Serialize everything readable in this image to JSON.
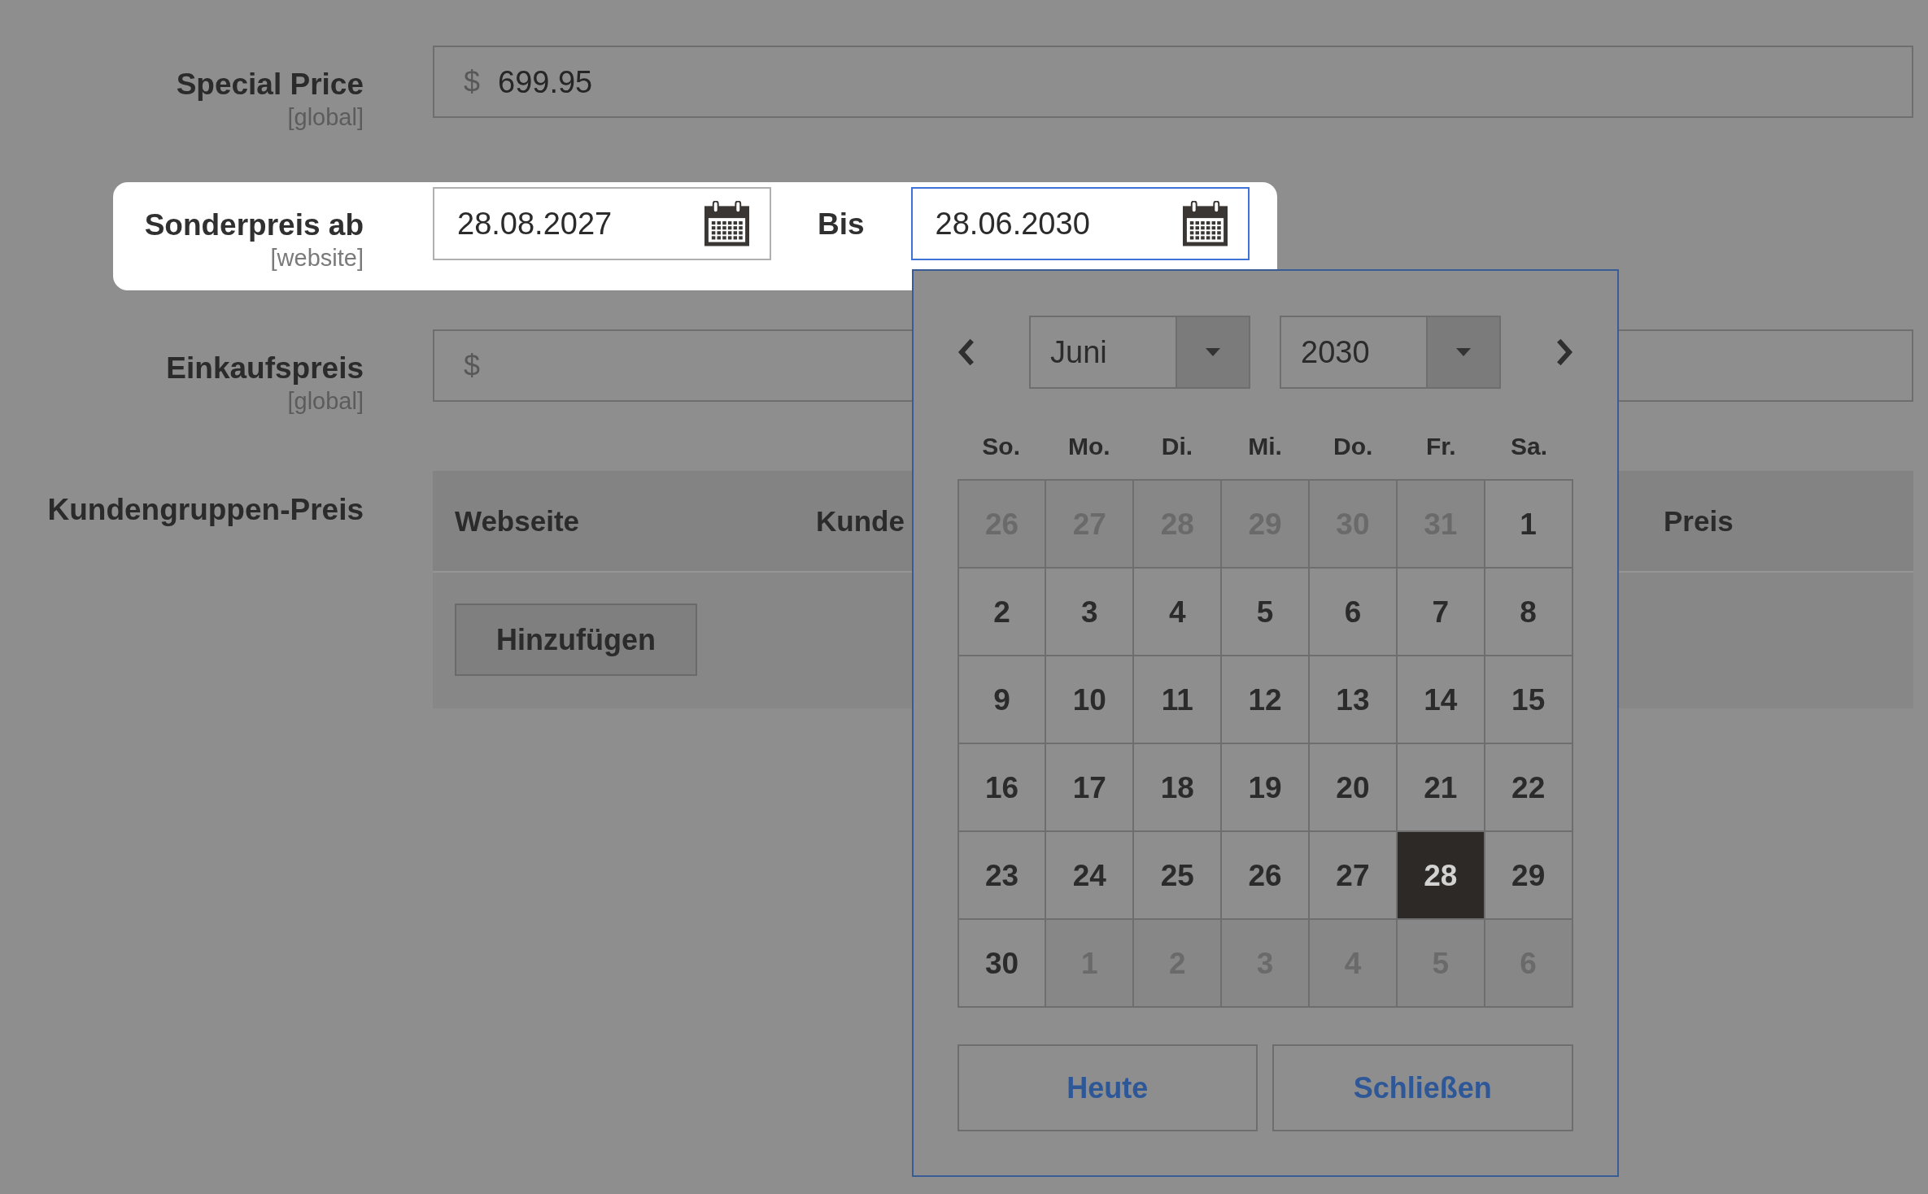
{
  "fields": [
    {
      "kind": "price",
      "label": "Special Price",
      "scope": "[global]",
      "currency": "$",
      "value": "699.95"
    },
    {
      "kind": "date_range",
      "label": "Sonderpreis ab",
      "scope": "[website]",
      "highlighted": true,
      "from": {
        "value": "28.08.2027",
        "focused": false
      },
      "separator": "Bis",
      "to": {
        "value": "28.06.2030",
        "focused": true
      }
    },
    {
      "kind": "price",
      "label": "Einkaufspreis",
      "scope": "[global]",
      "currency": "$"
    },
    {
      "kind": "table",
      "label": "Kundengruppen-Preis",
      "columns": [
        "Webseite",
        "Kunde",
        "Preis"
      ],
      "add_button": "Hinzufügen"
    }
  ],
  "calendar": {
    "month": "Juni",
    "year": "2030",
    "weekdays": [
      "So.",
      "Mo.",
      "Di.",
      "Mi.",
      "Do.",
      "Fr.",
      "Sa."
    ],
    "weeks": [
      [
        {
          "day": "26",
          "outside": true,
          "selected": false
        },
        {
          "day": "27",
          "outside": true,
          "selected": false
        },
        {
          "day": "28",
          "outside": true,
          "selected": false
        },
        {
          "day": "29",
          "outside": true,
          "selected": false
        },
        {
          "day": "30",
          "outside": true,
          "selected": false
        },
        {
          "day": "31",
          "outside": true,
          "selected": false
        },
        {
          "day": "1",
          "outside": false,
          "selected": false
        }
      ],
      [
        {
          "day": "2",
          "outside": false,
          "selected": false
        },
        {
          "day": "3",
          "outside": false,
          "selected": false
        },
        {
          "day": "4",
          "outside": false,
          "selected": false
        },
        {
          "day": "5",
          "outside": false,
          "selected": false
        },
        {
          "day": "6",
          "outside": false,
          "selected": false
        },
        {
          "day": "7",
          "outside": false,
          "selected": false
        },
        {
          "day": "8",
          "outside": false,
          "selected": false
        }
      ],
      [
        {
          "day": "9",
          "outside": false,
          "selected": false
        },
        {
          "day": "10",
          "outside": false,
          "selected": false
        },
        {
          "day": "11",
          "outside": false,
          "selected": false
        },
        {
          "day": "12",
          "outside": false,
          "selected": false
        },
        {
          "day": "13",
          "outside": false,
          "selected": false
        },
        {
          "day": "14",
          "outside": false,
          "selected": false
        },
        {
          "day": "15",
          "outside": false,
          "selected": false
        }
      ],
      [
        {
          "day": "16",
          "outside": false,
          "selected": false
        },
        {
          "day": "17",
          "outside": false,
          "selected": false
        },
        {
          "day": "18",
          "outside": false,
          "selected": false
        },
        {
          "day": "19",
          "outside": false,
          "selected": false
        },
        {
          "day": "20",
          "outside": false,
          "selected": false
        },
        {
          "day": "21",
          "outside": false,
          "selected": false
        },
        {
          "day": "22",
          "outside": false,
          "selected": false
        }
      ],
      [
        {
          "day": "23",
          "outside": false,
          "selected": false
        },
        {
          "day": "24",
          "outside": false,
          "selected": false
        },
        {
          "day": "25",
          "outside": false,
          "selected": false
        },
        {
          "day": "26",
          "outside": false,
          "selected": false
        },
        {
          "day": "27",
          "outside": false,
          "selected": false
        },
        {
          "day": "28",
          "outside": false,
          "selected": true
        },
        {
          "day": "29",
          "outside": false,
          "selected": false
        }
      ],
      [
        {
          "day": "30",
          "outside": false,
          "selected": false
        },
        {
          "day": "1",
          "outside": true,
          "selected": false
        },
        {
          "day": "2",
          "outside": true,
          "selected": false
        },
        {
          "day": "3",
          "outside": true,
          "selected": false
        },
        {
          "day": "4",
          "outside": true,
          "selected": false
        },
        {
          "day": "5",
          "outside": true,
          "selected": false
        },
        {
          "day": "6",
          "outside": true,
          "selected": false
        }
      ]
    ],
    "buttons": [
      "Heute",
      "Schließen"
    ]
  }
}
